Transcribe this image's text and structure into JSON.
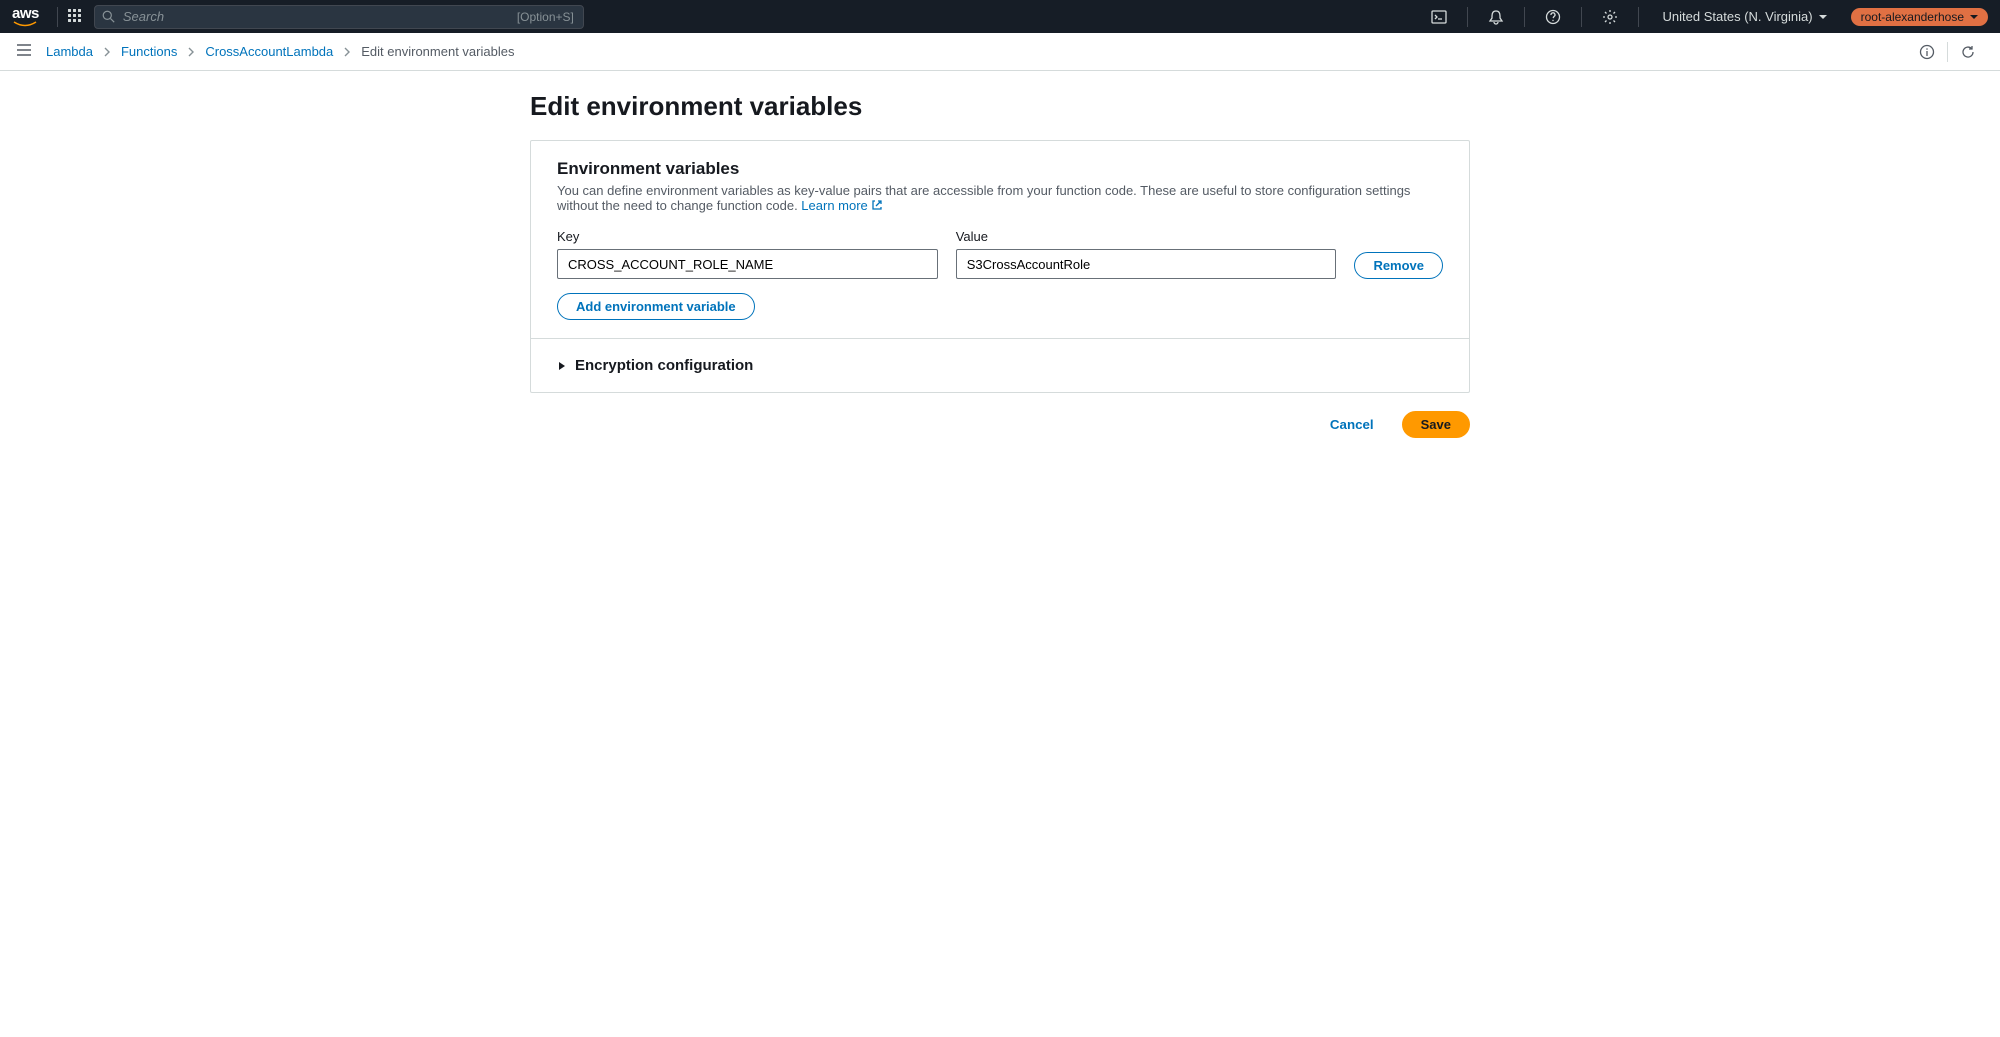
{
  "top_nav": {
    "logo_text": "aws",
    "search_placeholder": "Search",
    "search_hint": "[Option+S]",
    "region": "United States (N. Virginia)",
    "user": "root-alexanderhose"
  },
  "breadcrumb": {
    "items": [
      "Lambda",
      "Functions",
      "CrossAccountLambda"
    ],
    "current": "Edit environment variables"
  },
  "page": {
    "title": "Edit environment variables"
  },
  "env": {
    "section_title": "Environment variables",
    "section_desc": "You can define environment variables as key-value pairs that are accessible from your function code. These are useful to store configuration settings without the need to change function code. ",
    "learn_more": "Learn more",
    "key_label": "Key",
    "value_label": "Value",
    "rows": [
      {
        "key": "CROSS_ACCOUNT_ROLE_NAME",
        "value": "S3CrossAccountRole"
      }
    ],
    "remove_label": "Remove",
    "add_label": "Add environment variable"
  },
  "encryption": {
    "label": "Encryption configuration"
  },
  "actions": {
    "cancel": "Cancel",
    "save": "Save"
  }
}
